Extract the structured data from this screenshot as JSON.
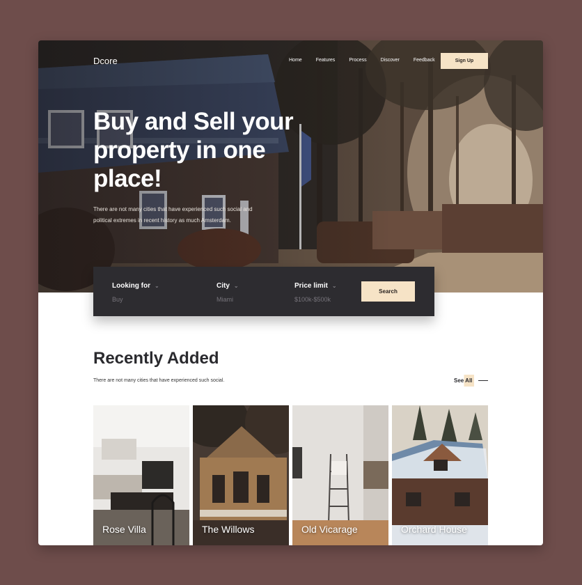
{
  "brand": {
    "logo": "Dcore"
  },
  "nav": {
    "items": [
      "Home",
      "Features",
      "Process",
      "Discover",
      "Feedback"
    ]
  },
  "header": {
    "signup_label": "Sign Up"
  },
  "hero": {
    "headline": "Buy and Sell your property in one place!",
    "subtitle": "There are not many cities that have experienced such social and political extremes in recent history as much Amsterdam."
  },
  "search": {
    "fields": [
      {
        "label": "Looking for",
        "value": "Buy"
      },
      {
        "label": "City",
        "value": "Miami"
      },
      {
        "label": "Price limit",
        "value": "$100k-$500k"
      }
    ],
    "button_label": "Search"
  },
  "recent": {
    "title": "Recently Added",
    "subtitle": "There are not many cities that have experienced such social.",
    "see_all_label": "See All",
    "cards": [
      {
        "name": "Rose Villa"
      },
      {
        "name": "The Willows"
      },
      {
        "name": "Old Vicarage"
      },
      {
        "name": "Orchard House"
      }
    ]
  },
  "colors": {
    "accent": "#f6e3c6",
    "dark": "#2d2c30",
    "background": "#6e4d4b"
  }
}
